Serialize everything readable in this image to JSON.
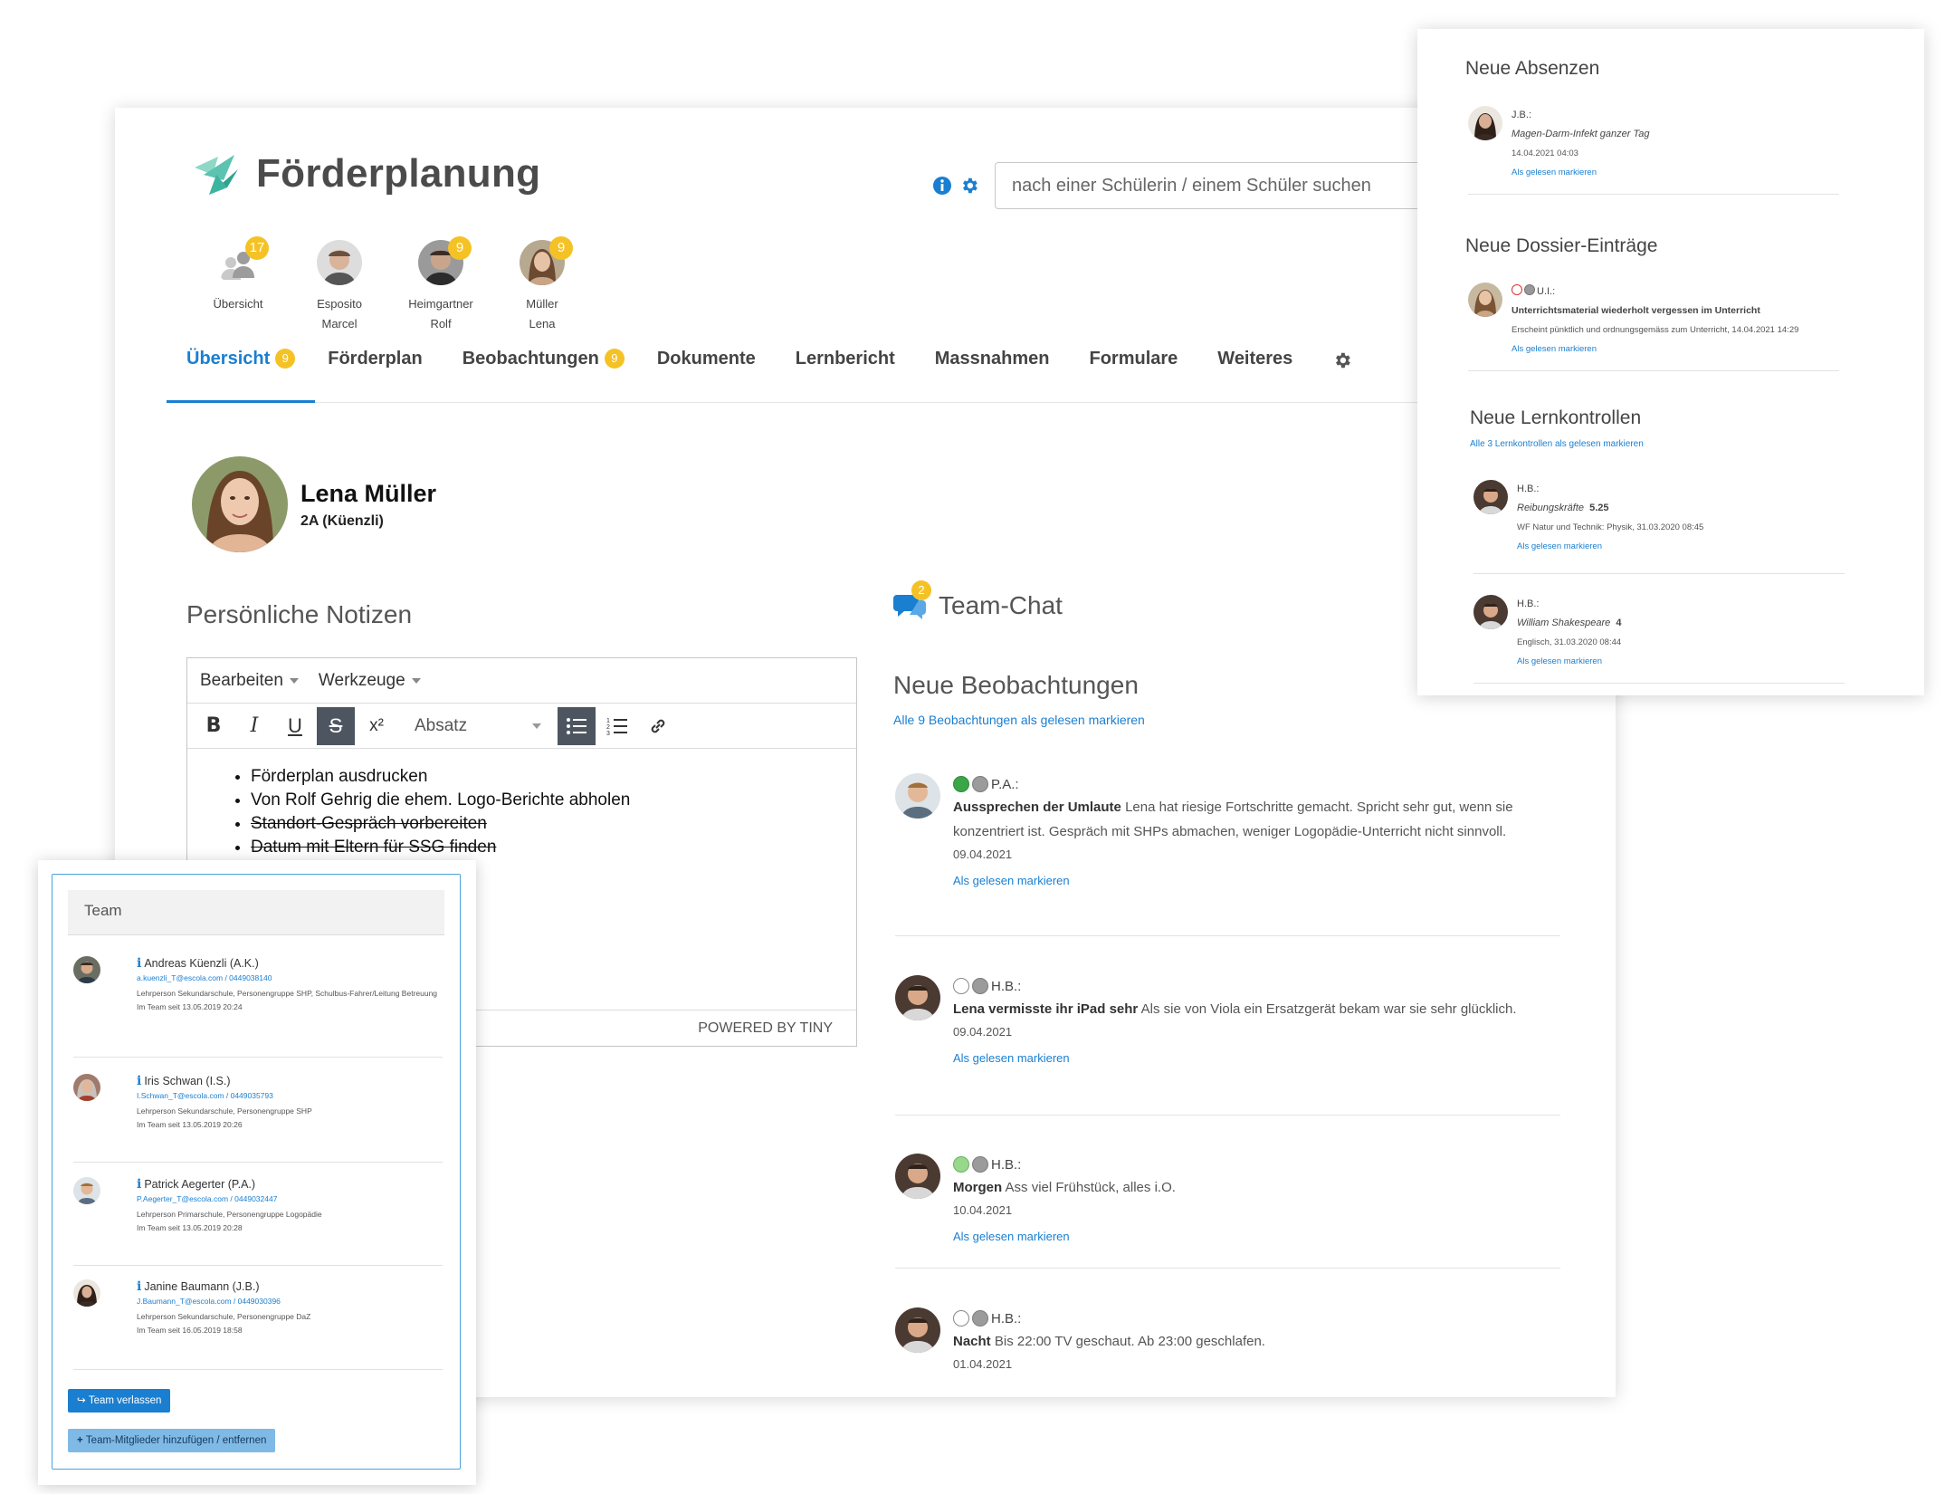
{
  "app": {
    "title": "Förderplanung",
    "search_placeholder": "nach einer Schülerin / einem Schüler suchen"
  },
  "people": [
    {
      "line1": "Übersicht",
      "line2": "",
      "badge": "17",
      "icon": "group-avatar"
    },
    {
      "line1": "Esposito",
      "line2": "Marcel",
      "badge": "",
      "icon": "avatar"
    },
    {
      "line1": "Heimgartner",
      "line2": "Rolf",
      "badge": "9",
      "icon": "avatar"
    },
    {
      "line1": "Müller",
      "line2": "Lena",
      "badge": "9",
      "icon": "avatar"
    }
  ],
  "tabs": [
    {
      "label": "Übersicht",
      "badge": "9",
      "active": true
    },
    {
      "label": "Förderplan",
      "badge": ""
    },
    {
      "label": "Beobachtungen",
      "badge": "9"
    },
    {
      "label": "Dokumente",
      "badge": ""
    },
    {
      "label": "Lernbericht",
      "badge": ""
    },
    {
      "label": "Massnahmen",
      "badge": ""
    },
    {
      "label": "Formulare",
      "badge": ""
    },
    {
      "label": "Weiteres",
      "badge": ""
    }
  ],
  "student": {
    "name": "Lena Müller",
    "class": "2A (Küenzli)"
  },
  "notes": {
    "title": "Persönliche Notizen",
    "menu": [
      "Bearbeiten",
      "Werkzeuge"
    ],
    "format": "Absatz",
    "items": [
      {
        "text": "Förderplan ausdrucken",
        "done": false
      },
      {
        "text": "Von Rolf Gehrig die ehem. Logo-Berichte abholen",
        "done": false
      },
      {
        "text": "Standort-Gespräch vorbereiten",
        "done": true
      },
      {
        "text": "Datum mit Eltern für SSG finden",
        "done": true
      }
    ],
    "powered": "POWERED BY TINY"
  },
  "chat": {
    "title": "Team-Chat",
    "badge": "2"
  },
  "observations": {
    "title": "Neue Beobachtungen",
    "mark_all": "Alle 9 Beobachtungen als gelesen markieren",
    "items": [
      {
        "author": "P.A.:",
        "dots": [
          "green",
          "gray"
        ],
        "title": "Aussprechen der Umlaute",
        "text": "Lena hat riesige Fortschritte gemacht. Spricht sehr gut, wenn sie konzentriert ist. Gespräch mit SHPs abmachen, weniger Logopädie-Unterricht nicht sinnvoll.",
        "date": "09.04.2021",
        "mark": "Als gelesen markieren"
      },
      {
        "author": "H.B.:",
        "dots": [
          "white",
          "gray"
        ],
        "title": "Lena vermisste ihr iPad sehr",
        "text": "Als sie von Viola ein Ersatzgerät bekam war sie sehr glücklich.",
        "date": "09.04.2021",
        "mark": "Als gelesen markieren"
      },
      {
        "author": "H.B.:",
        "dots": [
          "lightgreen",
          "gray"
        ],
        "title": "Morgen",
        "text": "Ass viel Frühstück, alles i.O.",
        "date": "10.04.2021",
        "mark": "Als gelesen markieren"
      },
      {
        "author": "H.B.:",
        "dots": [
          "white",
          "gray"
        ],
        "title": "Nacht",
        "text": "Bis 22:00 TV geschaut. Ab 23:00 geschlafen.",
        "date": "01.04.2021",
        "mark": ""
      }
    ]
  },
  "notifications": {
    "absences": {
      "title": "Neue Absenzen",
      "item": {
        "who": "J.B.:",
        "text": "Magen-Darm-Infekt ganzer Tag",
        "date": "14.04.2021 04:03",
        "mark": "Als gelesen markieren"
      }
    },
    "dossier": {
      "title": "Neue Dossier-Einträge",
      "item": {
        "who": "U.I.:",
        "title": "Unterrichtsmaterial wiederholt vergessen im Unterricht",
        "text": "Erscheint pünktlich und ordnungsgemäss zum Unterricht, 14.04.2021 14:29",
        "mark": "Als gelesen markieren"
      }
    },
    "tests": {
      "title": "Neue Lernkontrollen",
      "mark_all": "Alle 3 Lernkontrollen als gelesen markieren",
      "items": [
        {
          "who": "H.B.:",
          "subject": "Reibungskräfte",
          "grade": "5.25",
          "info": "WF Natur und Technik: Physik, 31.03.2020 08:45",
          "mark": "Als gelesen markieren"
        },
        {
          "who": "H.B.:",
          "subject": "William Shakespeare",
          "grade": "4",
          "info": "Englisch, 31.03.2020 08:44",
          "mark": "Als gelesen markieren"
        }
      ]
    }
  },
  "team": {
    "title": "Team",
    "members": [
      {
        "name": "Andreas Küenzli (A.K.)",
        "mail": "a.kuenzli_T@escola.com / 0449038140",
        "role": "Lehrperson Sekundarschule, Personengruppe SHP, Schulbus-Fahrer/Leitung Betreuung",
        "since": "Im Team seit 13.05.2019 20:24"
      },
      {
        "name": "Iris Schwan (I.S.)",
        "mail": "I.Schwan_T@escola.com / 0449035793",
        "role": "Lehrperson Sekundarschule, Personengruppe SHP",
        "since": "Im Team seit 13.05.2019 20:26"
      },
      {
        "name": "Patrick Aegerter (P.A.)",
        "mail": "P.Aegerter_T@escola.com / 0449032447",
        "role": "Lehrperson Primarschule, Personengruppe Logopädie",
        "since": "Im Team seit 13.05.2019 20:28"
      },
      {
        "name": "Janine Baumann (J.B.)",
        "mail": "J.Baumann_T@escola.com / 0449030396",
        "role": "Lehrperson Sekundarschule, Personengruppe DaZ",
        "since": "Im Team seit 16.05.2019 18:58"
      }
    ],
    "leave": "Team verlassen",
    "add": "Team-Mitglieder hinzufügen / entfernen"
  },
  "colors": {
    "accent": "#1a7fd1",
    "badge": "#f5c225",
    "logo": "#4bb9a6"
  }
}
